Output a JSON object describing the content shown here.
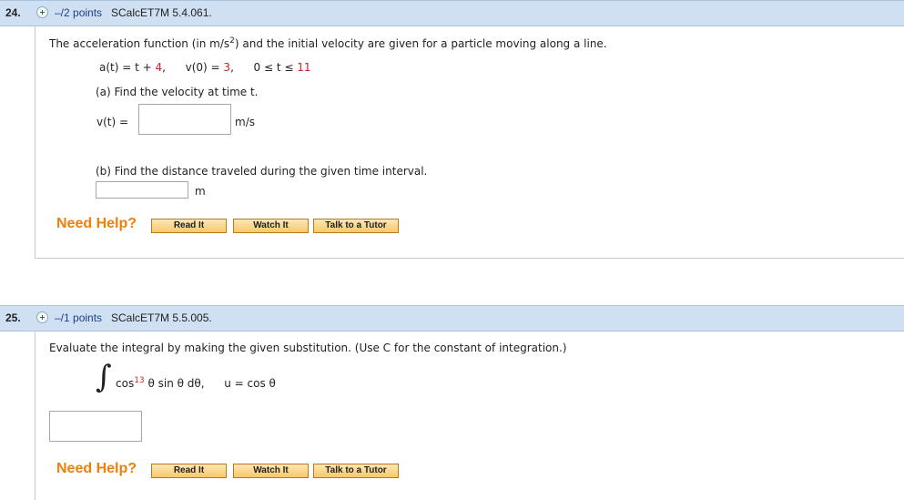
{
  "q24": {
    "number": "24.",
    "points": "–/2 points",
    "code": "SCalcET7M 5.4.061.",
    "intro_a": "The acceleration function (in m/s",
    "intro_sup": "2",
    "intro_b": ") and the initial velocity are given for a particle moving along a line.",
    "eq_a": "a(t) = t + ",
    "eq_a_val": "4",
    "eq_a_sep": ",",
    "eq_v": "v(0) = ",
    "eq_v_val": "3",
    "eq_v_sep": ",",
    "eq_range": "0 ≤ t ≤ ",
    "eq_range_val": "11",
    "part_a": "(a) Find the velocity at time t.",
    "vt_label": "v(t) =",
    "vt_value": "",
    "vt_unit": "m/s",
    "part_b": "(b) Find the distance traveled during the given time interval.",
    "dist_value": "",
    "dist_unit": "m",
    "need_help": "Need Help?",
    "btn_read": "Read It",
    "btn_watch": "Watch It",
    "btn_tutor": "Talk to a Tutor"
  },
  "q25": {
    "number": "25.",
    "points": "–/1 points",
    "code": "SCalcET7M 5.5.005.",
    "intro": "Evaluate the integral by making the given substitution. (Use C for the constant of integration.)",
    "integral_sign": "∫",
    "cos": "cos",
    "power": "13",
    "rest": " θ sin θ dθ,",
    "subst": "u = cos θ",
    "answer_value": "",
    "need_help": "Need Help?",
    "btn_read": "Read It",
    "btn_watch": "Watch It",
    "btn_tutor": "Talk to a Tutor"
  },
  "colors": {
    "header_bg": "#cfe0f2",
    "points_blue": "#1f3f8f",
    "help_orange": "#f07f09",
    "value_red": "#d0202a"
  }
}
